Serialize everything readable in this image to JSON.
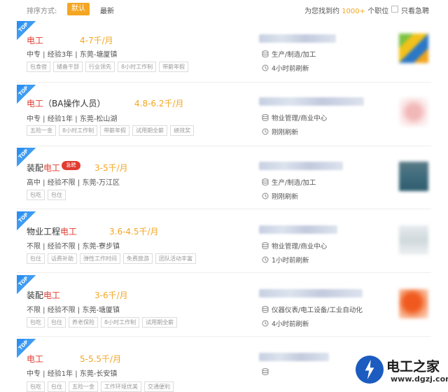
{
  "sort": {
    "label": "排序方式:",
    "default": "默认",
    "latest": "最新"
  },
  "found": {
    "prefix": "为您找到约",
    "count": "1000+",
    "suffix": "个职位"
  },
  "urgent_filter": "只看急聘",
  "top_badge": "TOP",
  "jobs": [
    {
      "title_pre": "",
      "title_hl": "电工",
      "title_post": "",
      "salary": "4-7千/月",
      "meta": "中专 | 经验3年 | 东莞-塘厦镇",
      "tags": [
        "包食宿",
        "储备干部",
        "行业领先",
        "8小时工作制",
        "带薪年假"
      ],
      "industry": "生产/制造/加工",
      "refresh": "4小时前刷新"
    },
    {
      "title_pre": "",
      "title_hl": "电工",
      "title_post": "（BA操作人员）",
      "salary": "4.8-6.2千/月",
      "meta": "中专 | 经验1年 | 东莞-松山湖",
      "tags": [
        "五险一金",
        "8小时工作制",
        "带薪年假",
        "试用期全薪",
        "绩效奖"
      ],
      "industry": "物业管理/商业中心",
      "refresh": "刚刚刷新"
    },
    {
      "title_pre": "装配",
      "title_hl": "电工",
      "title_post": "",
      "urgent": "急聘",
      "salary": "3-5千/月",
      "meta": "高中 | 经验不限 | 东莞-万江区",
      "tags": [
        "包吃",
        "包住"
      ],
      "industry": "生产/制造/加工",
      "refresh": "刚刚刷新"
    },
    {
      "title_pre": "物业工程",
      "title_hl": "电工",
      "title_post": "",
      "salary": "3.6-4.5千/月",
      "meta": "不限 | 经验不限 | 东莞-寮步镇",
      "tags": [
        "包住",
        "话费补助",
        "弹性工作时间",
        "免费旅游",
        "团队活动丰富"
      ],
      "industry": "物业管理/商业中心",
      "refresh": "1小时前刷新"
    },
    {
      "title_pre": "装配",
      "title_hl": "电工",
      "title_post": "",
      "salary": "3-6千/月",
      "meta": "不限 | 经验不限 | 东莞-塘厦镇",
      "tags": [
        "包吃",
        "包住",
        "养老保险",
        "8小时工作制",
        "试用期全薪"
      ],
      "industry": "仪器仪表/电工设备/工业自动化",
      "refresh": "4小时前刷新"
    },
    {
      "title_pre": "",
      "title_hl": "电工",
      "title_post": "",
      "salary": "5-5.5千/月",
      "meta": "中专 | 经验1年 | 东莞-长安镇",
      "tags": [
        "包吃",
        "包住",
        "五险一金",
        "工作环境优美",
        "交通便利"
      ],
      "industry": "",
      "refresh": ""
    }
  ],
  "watermark": {
    "title": "电工之家",
    "url": "www.dgzj.com"
  },
  "colors": {
    "accent": "#f4a623",
    "highlight": "#e23b30",
    "badge": "#2c8ff0"
  }
}
